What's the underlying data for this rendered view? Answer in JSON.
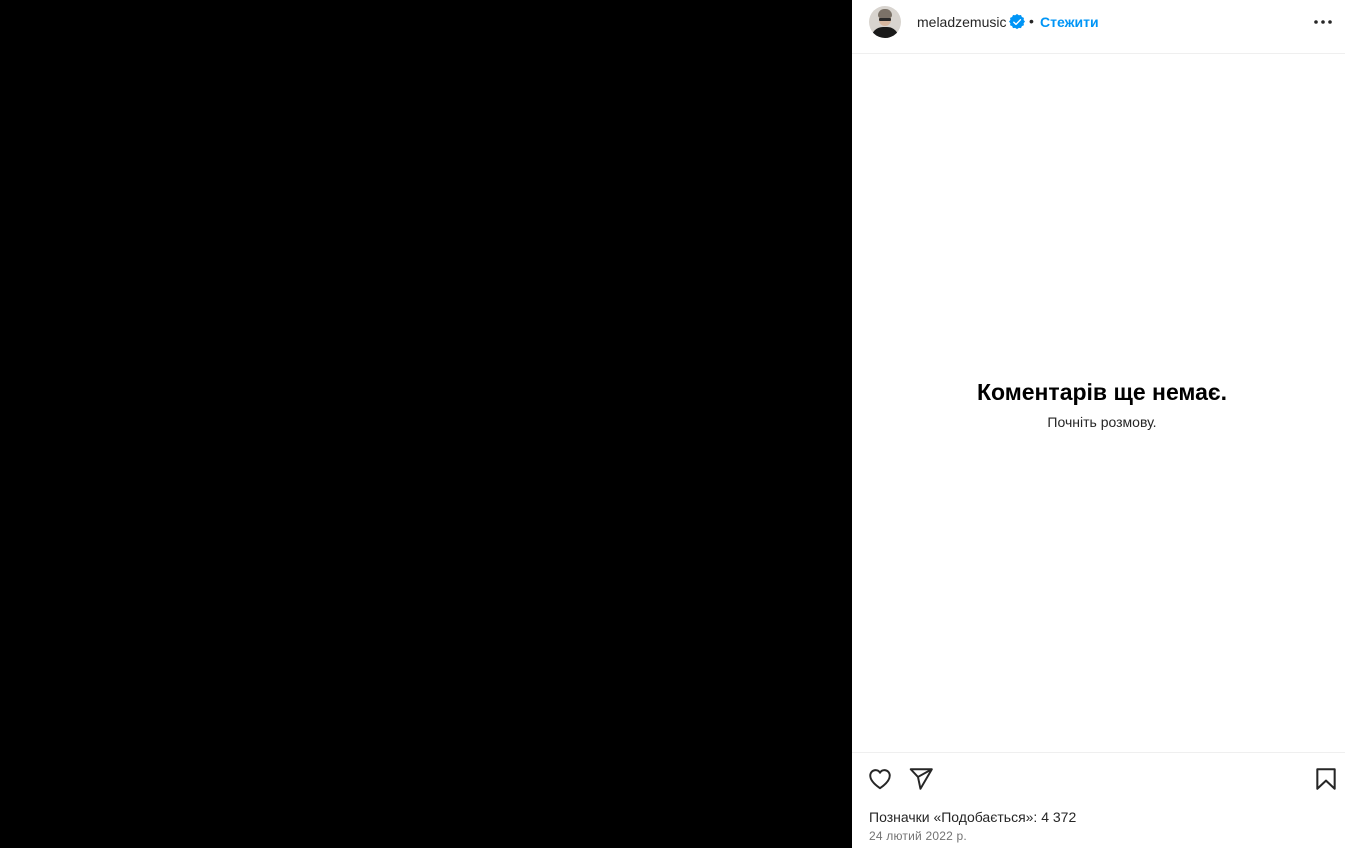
{
  "post": {
    "username": "meladzemusic",
    "verified": true,
    "separator": "•",
    "follow_label": "Стежити",
    "more_icon": "more-horizontal-icon"
  },
  "comments": {
    "empty_title": "Коментарів ще немає.",
    "empty_subtitle": "Почніть розмову."
  },
  "actions": {
    "like_icon": "heart-icon",
    "share_icon": "paper-plane-icon",
    "save_icon": "bookmark-icon"
  },
  "stats": {
    "likes_label": "Позначки «Подобається»:",
    "likes_count": "4 372",
    "date": "24 лютий 2022 р."
  },
  "colors": {
    "accent": "#0095f6",
    "verified_badge": "#0095f6",
    "media_background": "#000000"
  }
}
